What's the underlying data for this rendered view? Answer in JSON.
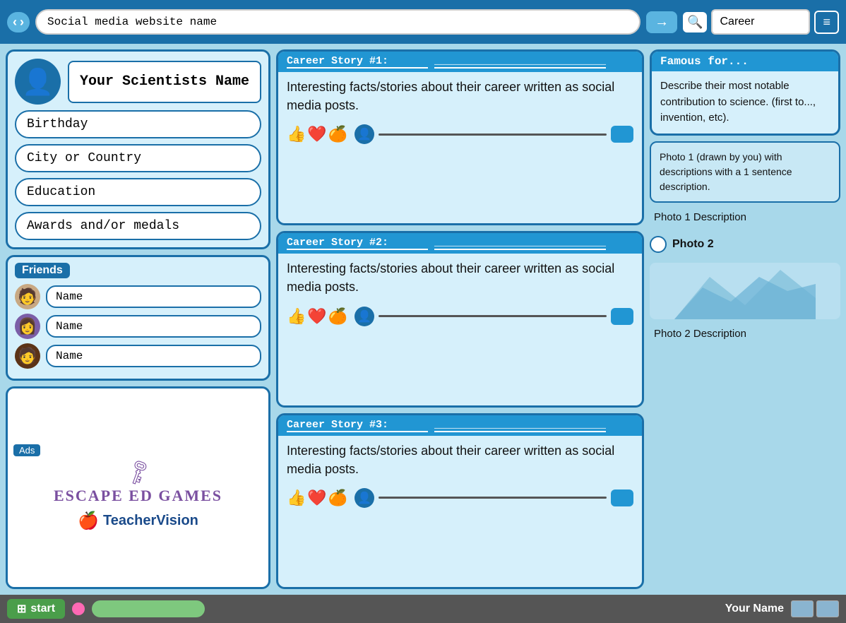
{
  "topbar": {
    "address": "Social media website name",
    "go_arrow": "→",
    "search_placeholder": "Career",
    "search_icon": "🔍",
    "menu_icon": "≡"
  },
  "profile": {
    "avatar_icon": "👤",
    "scientist_name": "Your Scientists Name",
    "birthday_label": "Birthday",
    "city_label": "City or Country",
    "education_label": "Education",
    "awards_label": "Awards and/or medals"
  },
  "friends": {
    "section_title": "Friends",
    "items": [
      {
        "avatar": "👦",
        "name": "Name",
        "skin": "#c8a882"
      },
      {
        "avatar": "👩",
        "name": "Name",
        "skin": "#7b5ea7"
      },
      {
        "avatar": "👦",
        "name": "Name",
        "skin": "#5c3317"
      }
    ]
  },
  "ads": {
    "label": "Ads",
    "escape_ed": {
      "key": "🗝",
      "text": "Escape Ed Games"
    },
    "teacher_vision": {
      "apple": "🍎",
      "text": "TeacherVision"
    }
  },
  "stories": [
    {
      "title": "Career Story #1:",
      "underline": "___________________________",
      "body": "Interesting facts/stories about their career written as social media posts.",
      "reactions": [
        "👍",
        "❤️",
        "🍊"
      ],
      "comment_placeholder": ""
    },
    {
      "title": "Career Story #2:",
      "underline": "___________________________",
      "body": "Interesting facts/stories about their career written as social media posts.",
      "reactions": [
        "👍",
        "❤️",
        "🍊"
      ],
      "comment_placeholder": ""
    },
    {
      "title": "Career Story #3:",
      "underline": "___________________________",
      "body": "Interesting facts/stories about their career written as social media posts.",
      "reactions": [
        "👍",
        "❤️",
        "🍊"
      ],
      "comment_placeholder": ""
    }
  ],
  "right_panel": {
    "famous_title": "Famous for...",
    "famous_body": "Describe their most notable contribution to science. (first to..., invention, etc).",
    "photo1_text": "Photo 1 (drawn by you) with descriptions with a 1 sentence description.",
    "photo1_desc": "Photo 1 Description",
    "photo2_label": "Photo 2",
    "photo2_desc": "Photo 2 Description"
  },
  "bottom_bar": {
    "start_label": "start",
    "start_icon": "⊞",
    "your_name": "Your Name"
  }
}
